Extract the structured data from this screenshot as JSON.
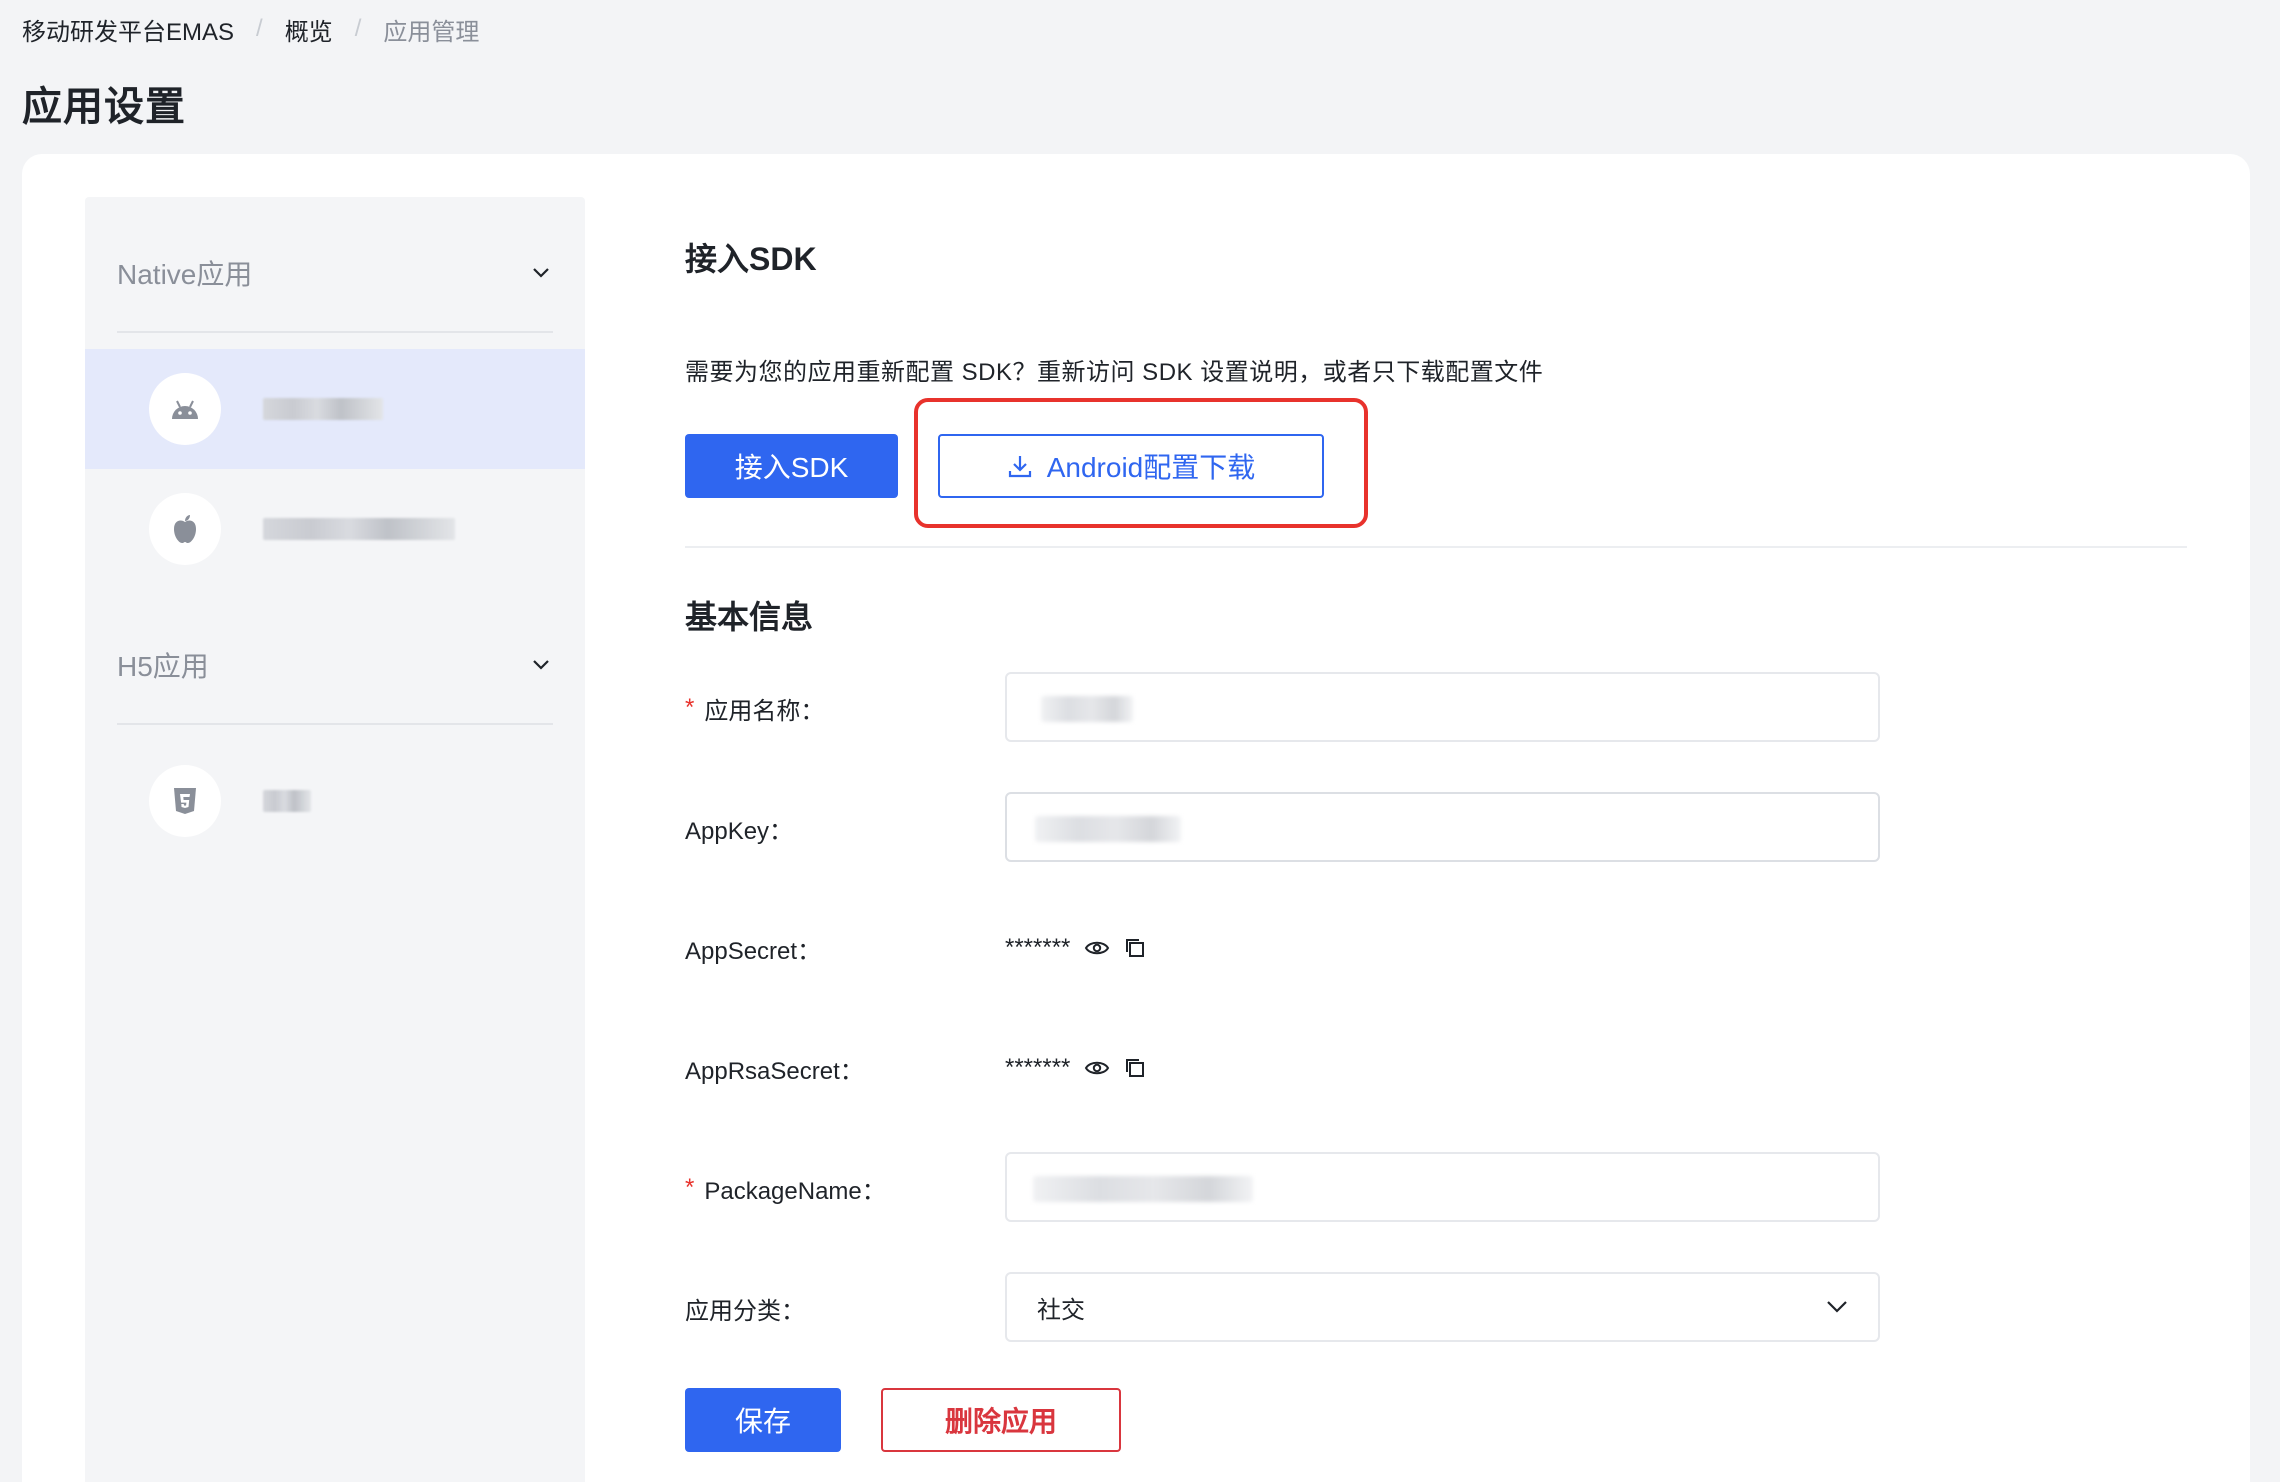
{
  "breadcrumb": {
    "items": [
      "移动研发平台EMAS",
      "概览",
      "应用管理"
    ],
    "separator": "/"
  },
  "page_title": "应用设置",
  "sidebar": {
    "groups": [
      {
        "label": "Native应用",
        "apps": [
          {
            "icon": "android-icon"
          },
          {
            "icon": "apple-icon"
          }
        ]
      },
      {
        "label": "H5应用",
        "apps": [
          {
            "icon": "html5-icon"
          }
        ]
      }
    ]
  },
  "sdk_section": {
    "title": "接入SDK",
    "hint": "需要为您的应用重新配置 SDK？重新访问 SDK 设置说明，或者只下载配置文件",
    "connect_button": "接入SDK",
    "download_button": "Android配置下载"
  },
  "basic_info": {
    "title": "基本信息",
    "app_name_label": "应用名称：",
    "appkey_label": "AppKey：",
    "appsecret_label": "AppSecret：",
    "appsecret_value": "*******",
    "apprsasecret_label": "AppRsaSecret：",
    "apprsasecret_value": "*******",
    "package_name_label": "PackageName：",
    "category_label": "应用分类：",
    "category_value": "社交",
    "required_mark": "*"
  },
  "actions": {
    "save": "保存",
    "delete": "删除应用"
  },
  "colors": {
    "primary": "#2f66f0",
    "danger": "#d9363e",
    "highlight": "#e8322c",
    "sidebar_active": "#e4e9fb"
  }
}
